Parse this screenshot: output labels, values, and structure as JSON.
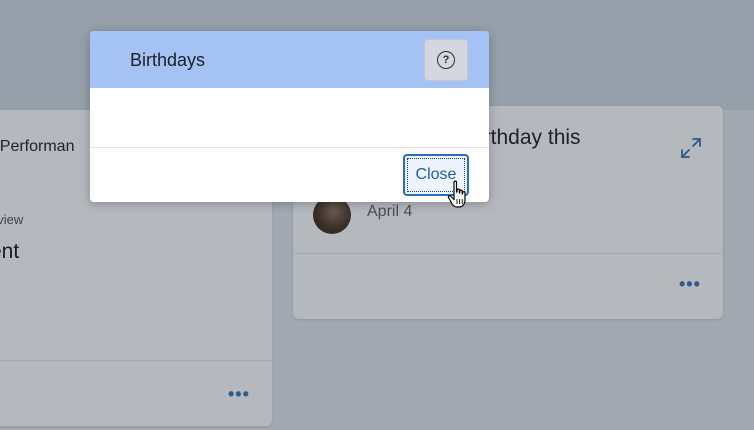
{
  "left_card": {
    "title": "r Performan",
    "subtitle": "eview",
    "value": "ent",
    "more_label": "•••"
  },
  "right_card": {
    "title": "irthday this",
    "birthday_date": "April 4",
    "more_label": "•••"
  },
  "dialog": {
    "title": "Birthdays",
    "help_icon_glyph": "?",
    "close_label": "Close"
  },
  "colors": {
    "header": "#a5c2f5",
    "accent": "#2a6fbd",
    "overlay": "#a2a9b1"
  },
  "icons": {
    "help": "question-circle-icon",
    "expand": "expand-icon",
    "more": "more-horizontal-icon",
    "cursor": "hand-pointer-cursor"
  }
}
